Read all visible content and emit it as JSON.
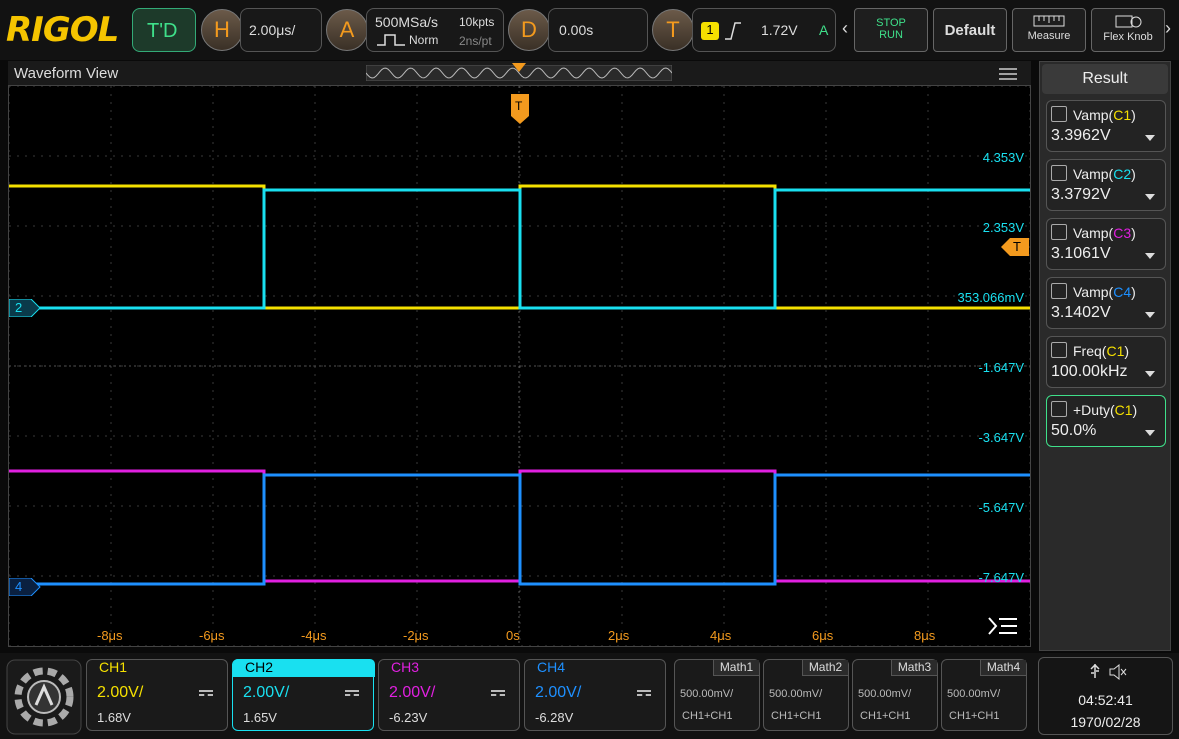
{
  "brand": "RIGOL",
  "toolbar": {
    "trigger_mode": "T'D",
    "h_label": "H",
    "h_scale": "2.00μs/",
    "a_label": "A",
    "sample_rate": "500MSa/s",
    "mem_depth": "10kpts",
    "acq_mode": "Norm",
    "time_per_pt": "2ns/pt",
    "d_label": "D",
    "delay": "0.00s",
    "t_label": "T",
    "trig_source": "1",
    "trig_level": "1.72V",
    "trig_status": "A",
    "stop": "STOP",
    "run": "RUN",
    "default": "Default",
    "measure": "Measure",
    "flex": "Flex Knob"
  },
  "waveform": {
    "title": "Waveform View",
    "trigger_marker": "T",
    "ch2_marker": "2",
    "ch4_marker": "4",
    "volt_labels": [
      "4.353V",
      "2.353V",
      "353.066mV",
      "-1.647V",
      "-3.647V",
      "-5.647V",
      "-7.647V"
    ],
    "time_labels": [
      "-8μs",
      "-6μs",
      "-4μs",
      "-2μs",
      "0s",
      "2μs",
      "4μs",
      "6μs",
      "8μs"
    ]
  },
  "results": {
    "title": "Result",
    "items": [
      {
        "name": "Vamp",
        "ch": "C1",
        "value": "3.3962V",
        "color": "#f5e000"
      },
      {
        "name": "Vamp",
        "ch": "C2",
        "value": "3.3792V",
        "color": "#19e0f0"
      },
      {
        "name": "Vamp",
        "ch": "C3",
        "value": "3.1061V",
        "color": "#e020e0"
      },
      {
        "name": "Vamp",
        "ch": "C4",
        "value": "3.1402V",
        "color": "#1e90ff"
      },
      {
        "name": "Freq",
        "ch": "C1",
        "value": "100.00kHz",
        "color": "#f5e000"
      },
      {
        "name": "+Duty",
        "ch": "C1",
        "value": "50.0%",
        "color": "#f5e000"
      }
    ]
  },
  "channels": [
    {
      "name": "CH1",
      "scale": "2.00V/",
      "offset": "1.68V",
      "color": "#f5e000"
    },
    {
      "name": "CH2",
      "scale": "2.00V/",
      "offset": "1.65V",
      "color": "#19e0f0"
    },
    {
      "name": "CH3",
      "scale": "2.00V/",
      "offset": "-6.23V",
      "color": "#e020e0"
    },
    {
      "name": "CH4",
      "scale": "2.00V/",
      "offset": "-6.28V",
      "color": "#1e90ff"
    }
  ],
  "maths": [
    {
      "name": "Math1",
      "scale": "500.00mV/",
      "src": "CH1+CH1"
    },
    {
      "name": "Math2",
      "scale": "500.00mV/",
      "src": "CH1+CH1"
    },
    {
      "name": "Math3",
      "scale": "500.00mV/",
      "src": "CH1+CH1"
    },
    {
      "name": "Math4",
      "scale": "500.00mV/",
      "src": "CH1+CH1"
    }
  ],
  "status": {
    "time": "04:52:41",
    "date": "1970/02/28",
    "usb_icon": "usb-icon",
    "mute_icon": "speaker-mute-icon"
  }
}
